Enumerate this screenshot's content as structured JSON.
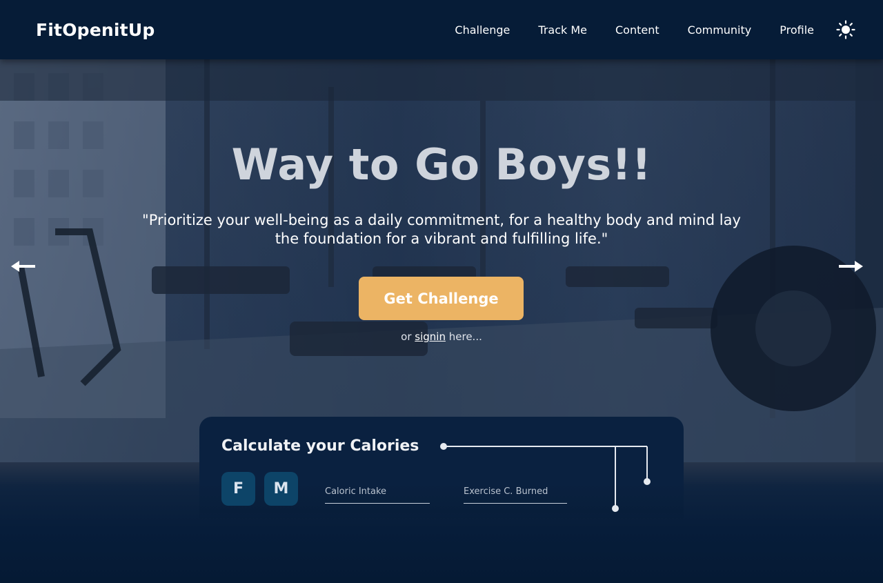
{
  "navbar": {
    "brand": "FitOpenitUp",
    "links": [
      "Challenge",
      "Track Me",
      "Content",
      "Community",
      "Profile"
    ],
    "theme_icon": "sun-icon"
  },
  "hero": {
    "title": "Way to Go Boys!!",
    "quote": "\"Prioritize your well-being as a daily commitment, for a healthy body and mind lay the foundation for a vibrant and fulfilling life.\"",
    "cta_label": "Get Challenge",
    "signin_prefix": "or",
    "signin_link": "signin",
    "signin_suffix": "here...",
    "prev_icon": "arrow-left-icon",
    "next_icon": "arrow-right-icon"
  },
  "calculator": {
    "title": "Calculate your Calories",
    "gender_female": "F",
    "gender_male": "M",
    "caloric_intake_placeholder": "Caloric Intake",
    "exercise_burned_placeholder": "Exercise C. Burned"
  },
  "colors": {
    "navbar_bg": "#061c37",
    "accent": "#ecb464",
    "gender_button": "#0d4468",
    "page_bg": "#051a34"
  }
}
